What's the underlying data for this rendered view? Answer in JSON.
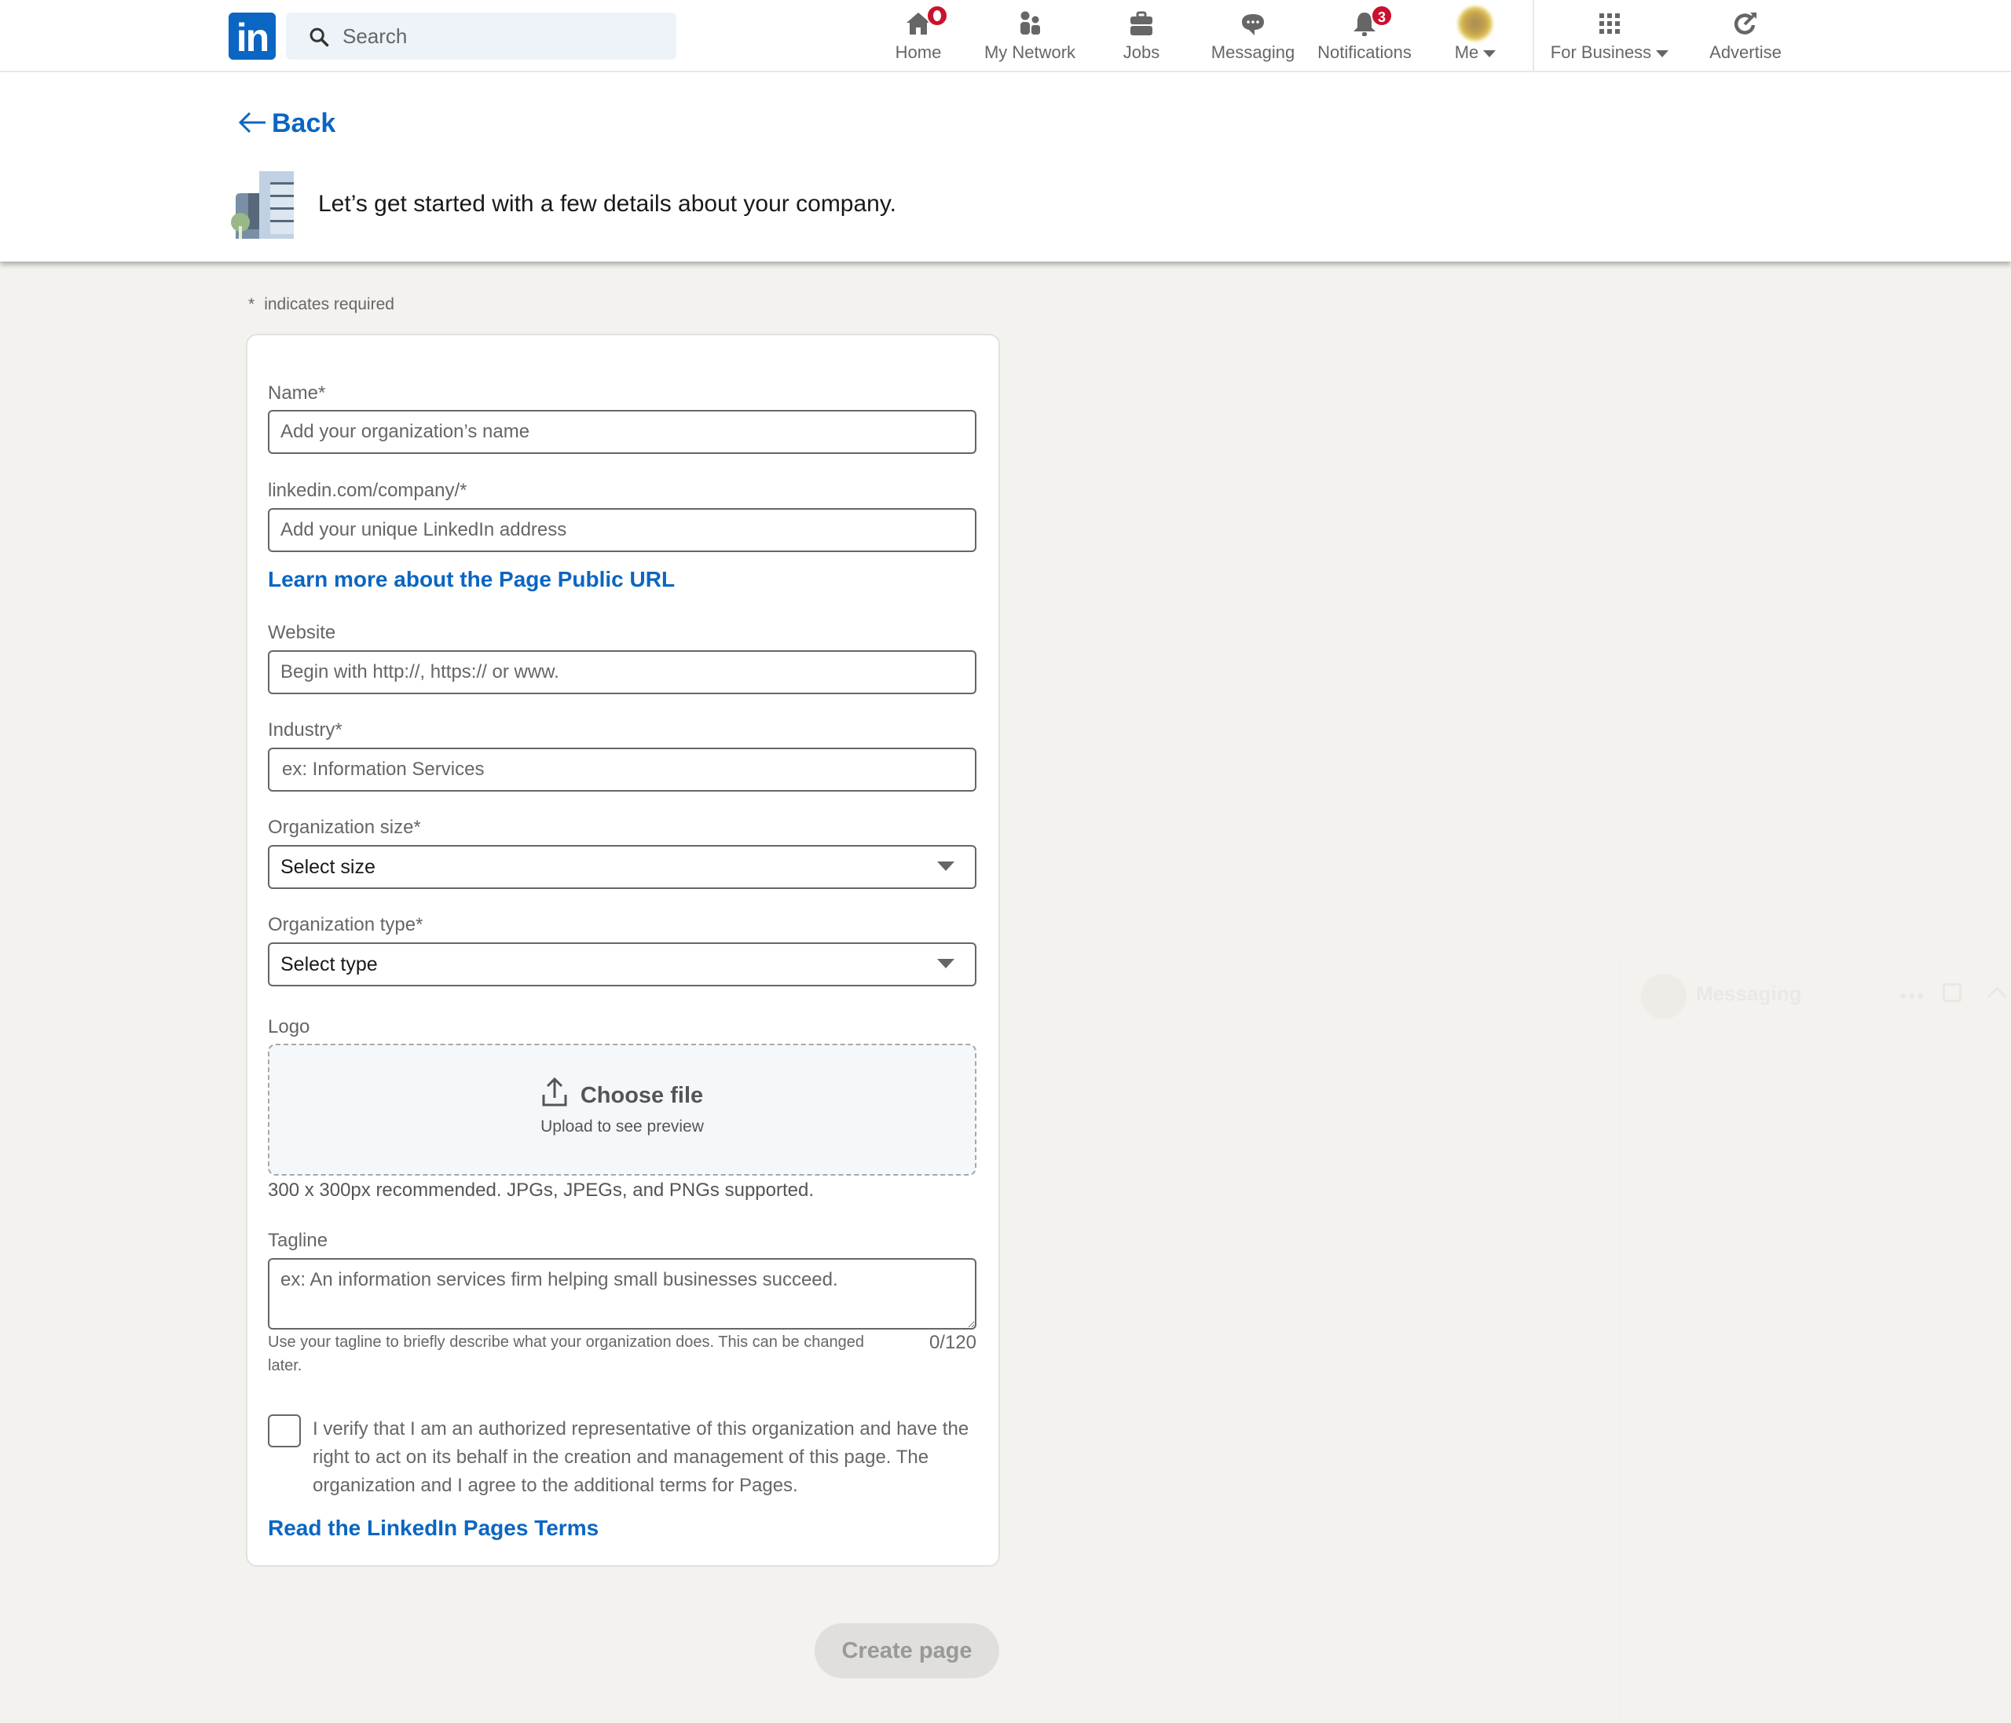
{
  "nav": {
    "search_placeholder": "Search",
    "items": [
      {
        "label": "Home",
        "icon": "home-icon",
        "badge": "dot"
      },
      {
        "label": "My Network",
        "icon": "people-icon"
      },
      {
        "label": "Jobs",
        "icon": "briefcase-icon"
      },
      {
        "label": "Messaging",
        "icon": "chat-bubble-icon"
      },
      {
        "label": "Notifications",
        "icon": "bell-icon",
        "badge": "3"
      },
      {
        "label": "Me",
        "icon": "avatar",
        "dropdown": true
      }
    ],
    "for_business": {
      "label": "For Business",
      "icon": "grid-icon",
      "dropdown": true
    },
    "advertise": {
      "label": "Advertise",
      "icon": "target-arrow-icon"
    }
  },
  "header": {
    "back_label": "Back",
    "title": "Let’s get started with a few details about your company."
  },
  "form": {
    "required_note_star": "*",
    "required_note": "indicates required",
    "name": {
      "label": "Name*",
      "placeholder": "Add your organization’s name",
      "value": ""
    },
    "public_url": {
      "label": "linkedin.com/company/*",
      "placeholder": "Add your unique LinkedIn address",
      "value": ""
    },
    "learn_more_link": "Learn more about the Page Public URL",
    "website": {
      "label": "Website",
      "placeholder": "Begin with http://, https:// or www.",
      "value": ""
    },
    "industry": {
      "label": "Industry*",
      "placeholder": "ex: Information Services",
      "value": ""
    },
    "org_size": {
      "label": "Organization size*",
      "selected": "Select size"
    },
    "org_type": {
      "label": "Organization type*",
      "selected": "Select type"
    },
    "logo": {
      "label": "Logo",
      "choose_file": "Choose file",
      "upload_hint": "Upload to see preview",
      "help": "300 x 300px recommended. JPGs, JPEGs, and PNGs supported."
    },
    "tagline": {
      "label": "Tagline",
      "placeholder": "ex: An information services firm helping small businesses succeed.",
      "value": "",
      "help": "Use your tagline to briefly describe what your organization does. This can be changed later.",
      "counter": "0/120"
    },
    "verify": {
      "checked": false,
      "text": "I verify that I am an authorized representative of this organization and have the right to act on its behalf in the creation and management of this page. The organization and I agree to the additional terms for Pages."
    },
    "terms_link": "Read the LinkedIn Pages Terms",
    "create_button": "Create page",
    "create_button_enabled": false
  },
  "messaging_overlay": {
    "title": "Messaging"
  },
  "colors": {
    "brand": "#0a66c2",
    "badge": "#cb112d",
    "page_bg": "#f3f2ef",
    "disabled_button_bg": "#e0dfdc"
  }
}
